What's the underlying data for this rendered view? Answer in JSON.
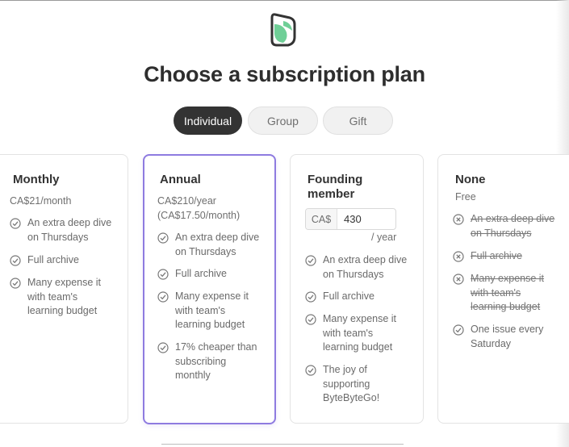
{
  "title": "Choose a subscription plan",
  "logo_icon": "bytebytego-logo",
  "tabs": [
    {
      "label": "Individual",
      "active": true
    },
    {
      "label": "Group",
      "active": false
    },
    {
      "label": "Gift",
      "active": false
    }
  ],
  "plans": [
    {
      "name": "Monthly",
      "price": "CA$21/month",
      "features": [
        "An extra deep dive on Thursdays",
        "Full archive",
        "Many expense it with team's learning budget"
      ]
    },
    {
      "name": "Annual",
      "price_line1": "CA$210/year",
      "price_line2": "(CA$17.50/month)",
      "selected": true,
      "features": [
        "An extra deep dive on Thursdays",
        "Full archive",
        "Many expense it with team's learning budget",
        "17% cheaper than subscribing monthly"
      ]
    },
    {
      "name_line1": "Founding",
      "name_line2": "member",
      "currency": "CA$",
      "amount": "430",
      "per": "/ year",
      "features": [
        "An extra deep dive on Thursdays",
        "Full archive",
        "Many expense it with team's learning budget",
        "The joy of supporting ByteByteGo!"
      ]
    },
    {
      "name": "None",
      "price": "Free",
      "features": [
        {
          "text": "An extra deep dive on Thursdays",
          "included": false
        },
        {
          "text": "Full archive",
          "included": false
        },
        {
          "text": "Many expense it with team's learning budget",
          "included": false
        },
        {
          "text": "One issue every Saturday",
          "included": true
        }
      ]
    }
  ],
  "colors": {
    "accent": "#8e7be0",
    "logo_green": "#6fcf97",
    "logo_dark": "#333333",
    "active_tab": "#333333"
  }
}
